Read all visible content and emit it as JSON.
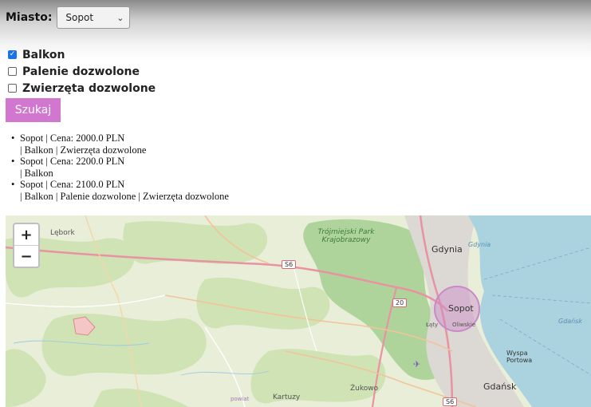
{
  "filters": {
    "city_label": "Miasto:",
    "city_value": "Sopot",
    "options": [
      {
        "label": "Balkon",
        "checked": true
      },
      {
        "label": "Palenie dozwolone",
        "checked": false
      },
      {
        "label": "Zwierzęta dozwolone",
        "checked": false
      }
    ],
    "search_label": "Szukaj"
  },
  "results": [
    {
      "line1": "Sopot | Cena: 2000.0 PLN",
      "line2": "| Balkon | Zwierzęta dozwolone"
    },
    {
      "line1": "Sopot | Cena: 2200.0 PLN",
      "line2": "| Balkon"
    },
    {
      "line1": "Sopot | Cena: 2100.0 PLN",
      "line2": "| Balkon | Palenie dozwolone | Zwierzęta dozwolone"
    }
  ],
  "map": {
    "zoom_in": "+",
    "zoom_out": "−",
    "labels": {
      "lebork": "Lębork",
      "park": "Trójmiejski Park Krajobrazowy",
      "gdynia": "Gdynia",
      "gdynia_water": "Gdynia",
      "sopot": "Sopot",
      "gdansk_water": "Gdańsk",
      "wyspa": "Wyspa Portowa",
      "gdansk": "Gdańsk",
      "kartuzy": "Kartuzy",
      "zukowo": "Żukowo",
      "powiat": "powiat",
      "laty": "Łąty",
      "oliwskie": "Oliwskie"
    },
    "road_labels": {
      "s6_north": "S6",
      "r20": "20",
      "s6_south": "S6"
    },
    "marker_color": "#c98ac7",
    "sea_color": "#aad3df"
  }
}
